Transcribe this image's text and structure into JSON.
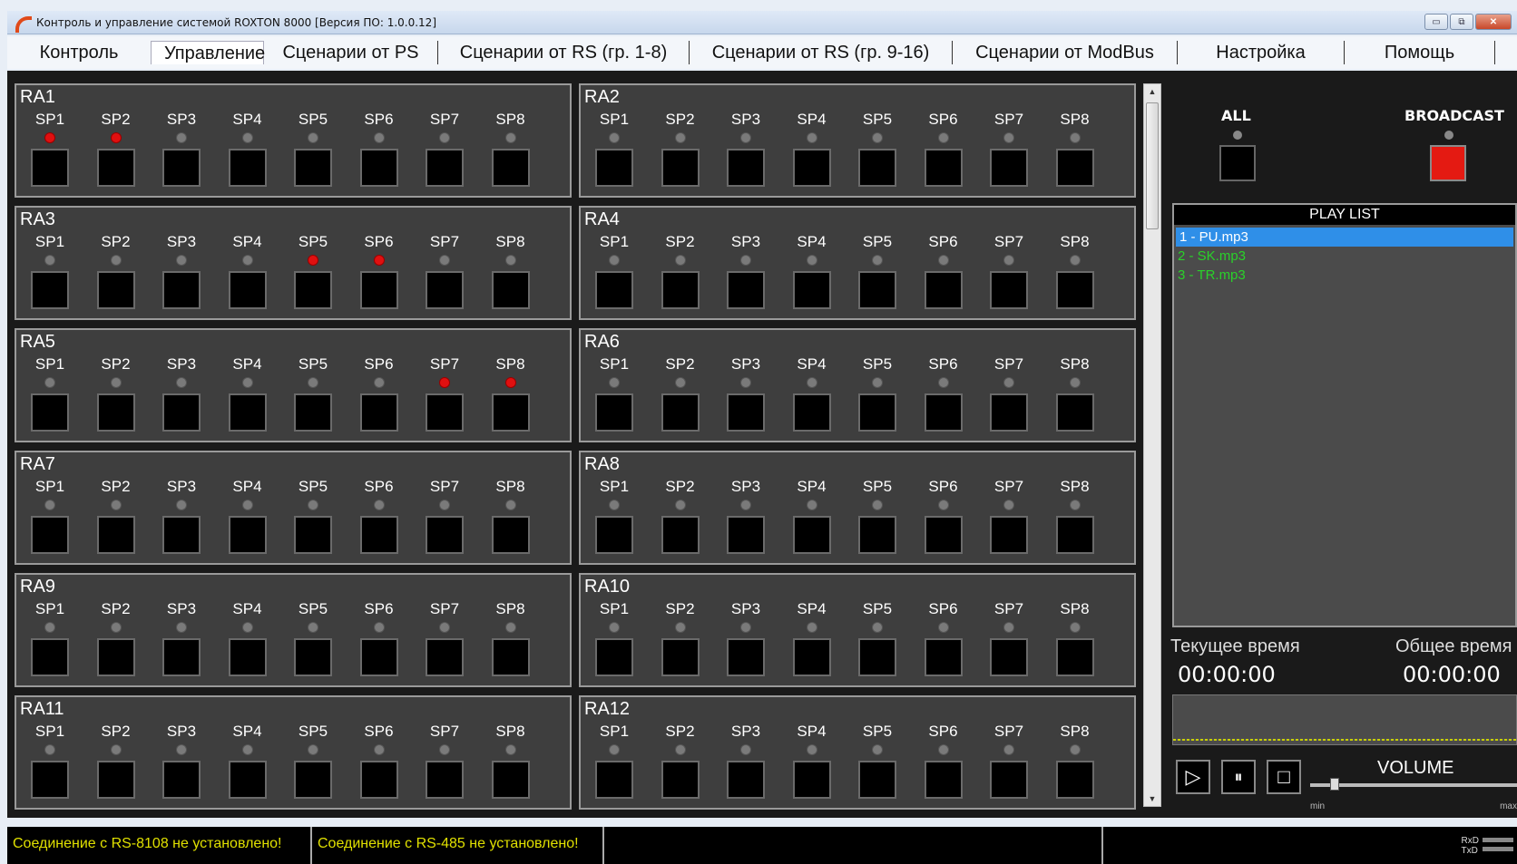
{
  "window": {
    "title": "Контроль и управление системой ROXTON 8000 [Версия ПО: 1.0.0.12]",
    "minimize": "▭",
    "restore": "⧉",
    "close": "✕"
  },
  "menu": [
    "Контроль",
    "Управление",
    "Сценарии от PS",
    "Сценарии от RS (гр. 1-8)",
    "Сценарии от RS (гр. 9-16)",
    "Сценарии от ModBus",
    "Настройка",
    "Помощь"
  ],
  "menu_active": 1,
  "panels": [
    {
      "name": "RA1",
      "leds_on": [
        1,
        2
      ]
    },
    {
      "name": "RA2",
      "leds_on": []
    },
    {
      "name": "RA3",
      "leds_on": [
        5,
        6
      ]
    },
    {
      "name": "RA4",
      "leds_on": []
    },
    {
      "name": "RA5",
      "leds_on": [
        7,
        8
      ]
    },
    {
      "name": "RA6",
      "leds_on": []
    },
    {
      "name": "RA7",
      "leds_on": []
    },
    {
      "name": "RA8",
      "leds_on": []
    },
    {
      "name": "RA9",
      "leds_on": []
    },
    {
      "name": "RA10",
      "leds_on": []
    },
    {
      "name": "RA11",
      "leds_on": []
    },
    {
      "name": "RA12",
      "leds_on": []
    }
  ],
  "sp_labels": [
    "SP1",
    "SP2",
    "SP3",
    "SP4",
    "SP5",
    "SP6",
    "SP7",
    "SP8"
  ],
  "right": {
    "all_label": "ALL",
    "broadcast_label": "BROADCAST",
    "playlist_header": "PLAY LIST",
    "playlist": [
      "1 - PU.mp3",
      "2 - SK.mp3",
      "3 - TR.mp3"
    ],
    "current_time_label": "Текущее время",
    "total_time_label": "Общее время",
    "current_time": "00:00:00",
    "total_time": "00:00:00",
    "volume_label": "VOLUME",
    "vol_min": "min",
    "vol_max": "max",
    "play_icon": "▷",
    "pause_icon": "⏸",
    "stop_icon": "□"
  },
  "status": {
    "seg1": "Соединение с RS-8108 не установлено!",
    "seg2": "Соединение с RS-485 не установлено!",
    "rxd": "RxD",
    "txd": "TxD"
  },
  "colors": {
    "led_on": "#e01010",
    "broadcast": "#e41a12",
    "playlist_text": "#2ad12a",
    "status_text": "#e0e000"
  }
}
